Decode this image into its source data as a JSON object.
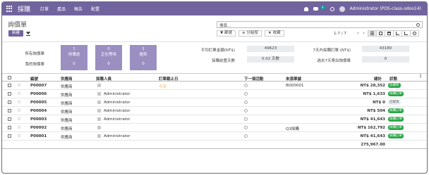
{
  "navbar": {
    "brand": "採購",
    "menus": [
      "訂單",
      "產品",
      "報告",
      "配置"
    ],
    "chat_badge": "4",
    "user": "Administrator (POS-class-odoo14)"
  },
  "control_panel": {
    "title": "詢價單",
    "new_label": "新建",
    "search_placeholder": "搜尋...",
    "filter_label": "篩選",
    "group_label": "分組按",
    "favorite_label": "收藏",
    "pager": "1-7 / 7"
  },
  "dashboard": {
    "all_rfq_label": "所有詢價單",
    "my_rfq_label": "我的詢價單",
    "tiles": [
      {
        "label": "待傳送",
        "all": "1",
        "mine": "0"
      },
      {
        "label": "正在等待",
        "all": "0",
        "mine": "0"
      },
      {
        "label": "遲到",
        "all": "1",
        "mine": "0"
      }
    ],
    "stats": {
      "avg_order_label": "平均訂單金額(NT$)",
      "avg_order_value": "49623",
      "lead_time_label": "採購前置天數",
      "lead_time_value": "0.02 天數",
      "last7_label": "7天內採購訂單 (NT$)",
      "last7_value": "43180",
      "rfq_sent_label": "過去7天寄出詢價單",
      "rfq_sent_value": "0"
    }
  },
  "list": {
    "columns": [
      "編號",
      "供應商",
      "採購人員",
      "訂單截止日",
      "下一個活動",
      "來源單據",
      "總計",
      "狀態"
    ],
    "rows": [
      {
        "ref": "P00007",
        "vendor": "供應商",
        "buyer": "",
        "deadline": "今天",
        "source": "BO00001",
        "total": "NT$ 28,352",
        "status": "詢價單",
        "status_kind": "green"
      },
      {
        "ref": "P00006",
        "vendor": "供應商",
        "buyer": "Administrator",
        "deadline": "",
        "source": "",
        "total": "NT$ 1,633",
        "status": "採購訂單",
        "status_kind": "green"
      },
      {
        "ref": "P00005",
        "vendor": "供應商",
        "buyer": "Administrator",
        "deadline": "",
        "source": "",
        "total": "NT$ 0",
        "status": "已取消",
        "status_kind": "gray"
      },
      {
        "ref": "P00004",
        "vendor": "供應商",
        "buyer": "Administrator",
        "deadline": "",
        "source": "",
        "total": "NT$ 504",
        "status": "採購訂單",
        "status_kind": "green"
      },
      {
        "ref": "P00003",
        "vendor": "供應商",
        "buyer": "Administrator",
        "deadline": "",
        "source": "",
        "total": "NT$ 41,643",
        "status": "採購訂單",
        "status_kind": "green"
      },
      {
        "ref": "P00002",
        "vendor": "供應商",
        "buyer": "",
        "deadline": "",
        "source": "Q3採購",
        "total": "NT$ 162,792",
        "status": "採購訂單",
        "status_kind": "green"
      },
      {
        "ref": "P00001",
        "vendor": "供應商",
        "buyer": "Administrator",
        "deadline": "",
        "source": "",
        "total": "NT$ 41,643",
        "status": "採購訂單",
        "status_kind": "green"
      }
    ],
    "grand_total": "275,967.00"
  }
}
